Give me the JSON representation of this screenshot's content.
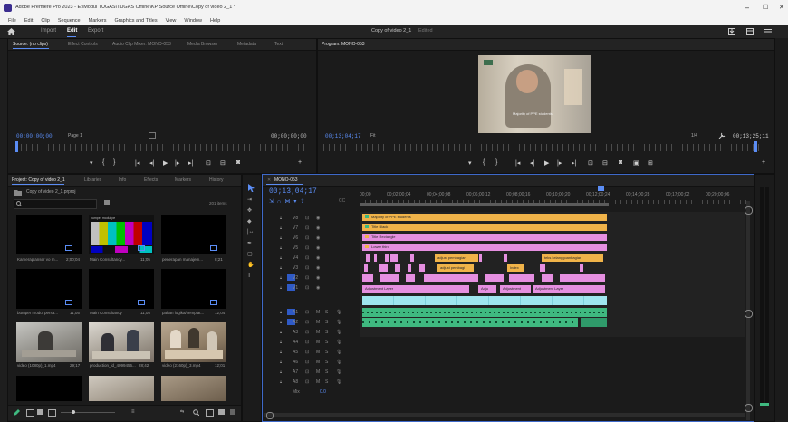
{
  "window": {
    "title": "Adobe Premiere Pro 2023 - E:\\Modul TUGAS\\TUGAS Offline\\KP Source Offline\\Copy of video 2_1 *",
    "controls": [
      "–",
      "☐",
      "✕"
    ]
  },
  "menu": [
    "File",
    "Edit",
    "Clip",
    "Sequence",
    "Markers",
    "Graphics and Titles",
    "View",
    "Window",
    "Help"
  ],
  "workspace": {
    "tabs": [
      "Import",
      "Edit",
      "Export"
    ],
    "active": "Edit",
    "center_title": "Copy of video 2_1",
    "center_status": "Edited"
  },
  "source_panel": {
    "tabs": [
      "Source: (no clips)",
      "Effect Controls",
      "Audio Clip Mixer: MONO-053",
      "Media Browser",
      "Metadata",
      "Text"
    ],
    "timecode_left": "00;00;00;00",
    "page": "Page 1",
    "timecode_right": "00;00;00;00"
  },
  "program_panel": {
    "tab": "Program: MONO-053",
    "timecode": "00;13;04;17",
    "fit": "Fit",
    "zoom": "1/4",
    "duration": "00;13;25;11",
    "video_caption": "Majority of PPE students"
  },
  "project_panel": {
    "tabs": [
      "Project: Copy of video 2_1",
      "Libraries",
      "Info",
      "Effects",
      "Markers",
      "History"
    ],
    "bin_path": "Copy of video 2_1.prproj",
    "search_placeholder": "",
    "items_count": "201 items",
    "items": [
      {
        "name": "Kameraplanser vo m...",
        "duration": "2;00;04"
      },
      {
        "name": "Main Consultancy...",
        "duration": "11;05"
      },
      {
        "name": "penerapan manajem...",
        "duration": "8;21"
      },
      {
        "name": "bumper modul persa...",
        "duration": "11;05"
      },
      {
        "name": "Main Consultancy",
        "duration": "11;05"
      },
      {
        "name": "pahan logika/Templat...",
        "duration": "12;04"
      },
      {
        "name": "video (1080p)_1.mp4",
        "duration": "29;17"
      },
      {
        "name": "production_id_4099456...",
        "duration": "28;42"
      },
      {
        "name": "video (2160p)_3.mp4",
        "duration": "12;01"
      }
    ]
  },
  "timeline": {
    "sequence": "MONO-053",
    "timecode": "00;13;04;17",
    "ruler_labels": [
      "00;00",
      "00;02;00;04",
      "00;04;00;08",
      "00;06;00;12",
      "00;08;00;16",
      "00;10;00;20",
      "00;12;00;24",
      "00;14;00;28",
      "00;17;00;02",
      "00;20;00;06"
    ],
    "video_tracks": [
      "V8",
      "V7",
      "V6",
      "V5",
      "V4",
      "V3",
      "V2",
      "V1"
    ],
    "audio_tracks": [
      "A1",
      "A2",
      "A3",
      "A4",
      "A5",
      "A6",
      "A7",
      "A8"
    ],
    "mix_label": "Mix",
    "mix_value": "0.0",
    "clips": [
      {
        "label": "Majority of PPE students",
        "color": "#f0b349"
      },
      {
        "label": "Title Black",
        "color": "#f0b349"
      },
      {
        "label": "Title Rectangle",
        "color": "#e58fe0"
      },
      {
        "label": "Lower third",
        "color": "#e58fe0"
      },
      {
        "label": "adjust pembagian",
        "color": "#f0b349"
      },
      {
        "label": "teks kelanggoanbagian",
        "color": "#f0b349"
      },
      {
        "label": "adjust pembagi",
        "color": "#f0b349"
      },
      {
        "label": "Index",
        "color": "#f0b349"
      },
      {
        "label": "Adjustment Layer",
        "color": "#e58fe0"
      },
      {
        "label": "Adju",
        "color": "#e58fe0"
      },
      {
        "label": "Adjustment",
        "color": "#e58fe0"
      },
      {
        "label": "Adjustment Layer",
        "color": "#e58fe0"
      }
    ]
  },
  "colors": {
    "accent_blue": "#5b8df5",
    "clip_orange": "#f0b349",
    "clip_pink": "#e58fe0",
    "clip_cyan": "#9fe6ef",
    "clip_green": "#3fb980"
  }
}
